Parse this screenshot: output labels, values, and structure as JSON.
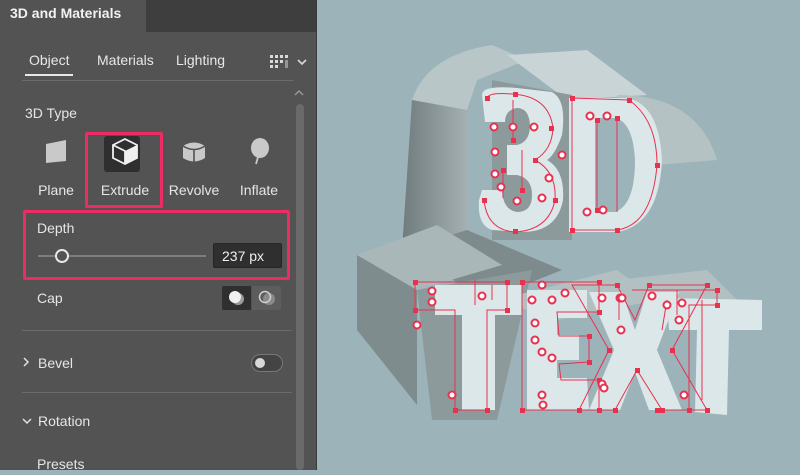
{
  "panel": {
    "title": "3D and Materials",
    "tabs": {
      "object": "Object",
      "materials": "Materials",
      "lighting": "Lighting"
    },
    "section_3d_type": "3D Type",
    "types": [
      {
        "label": "Plane",
        "icon": "plane-icon"
      },
      {
        "label": "Extrude",
        "icon": "extrude-cube-icon"
      },
      {
        "label": "Revolve",
        "icon": "revolve-cylinder-icon"
      },
      {
        "label": "Inflate",
        "icon": "inflate-balloon-icon"
      }
    ],
    "selected_type": "Extrude",
    "depth": {
      "label": "Depth",
      "value": "237 px"
    },
    "cap": {
      "label": "Cap",
      "selected": "cap-on"
    },
    "bevel": {
      "label": "Bevel",
      "enabled": false
    },
    "rotation": {
      "label": "Rotation"
    },
    "presets": {
      "label": "Presets"
    }
  },
  "canvas": {
    "artwork_text": [
      "3D",
      "TEXT"
    ]
  },
  "colors": {
    "panel_bg": "#535353",
    "tabbar_bg": "#3e3e3e",
    "highlight": "#ec2d64",
    "canvas_bg": "#9cb4b9",
    "anchor_color": "#e8304f",
    "text_face": "#d9e6e8"
  }
}
